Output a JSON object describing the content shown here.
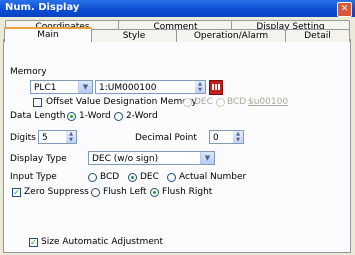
{
  "window": {
    "title": "Num. Display"
  },
  "tabs_back": [
    "Coordinates",
    "Comment",
    "Display Setting"
  ],
  "tabs_front": [
    "Main",
    "Style",
    "Operation/Alarm",
    "Detail"
  ],
  "memory": {
    "label": "Memory",
    "plc_value": "PLC1",
    "address_value": "1:UM000100",
    "offset_label": "Offset Value Designation Memory",
    "offset_dec": "DEC",
    "offset_bcd": "BCD",
    "offset_address": "$u00100"
  },
  "data_length": {
    "label": "Data Length",
    "opt1": "1-Word",
    "opt2": "2-Word"
  },
  "digits": {
    "label": "Digits",
    "value": "5"
  },
  "decimal_point": {
    "label": "Decimal Point",
    "value": "0"
  },
  "display_type": {
    "label": "Display Type",
    "value": "DEC (w/o sign)"
  },
  "input_type": {
    "label": "Input Type",
    "opt1": "BCD",
    "opt2": "DEC",
    "opt3": "Actual Number"
  },
  "alignment": {
    "zero_suppress": "Zero Suppress",
    "flush_left": "Flush Left",
    "flush_right": "Flush Right"
  },
  "size_auto": "Size Automatic Adjustment"
}
